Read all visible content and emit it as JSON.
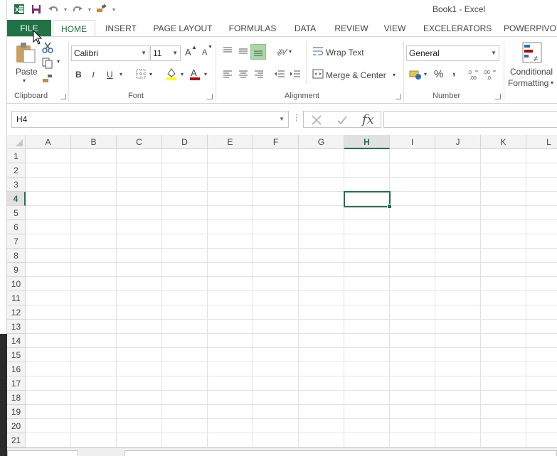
{
  "window": {
    "title": "Book1 - Excel"
  },
  "qat": {
    "icons": [
      "excel-logo-icon",
      "save-icon",
      "undo-icon",
      "redo-icon",
      "format-painter-icon",
      "customize-qat-icon"
    ]
  },
  "tabs": [
    {
      "key": "file",
      "label": "FILE"
    },
    {
      "key": "home",
      "label": "HOME"
    },
    {
      "key": "insert",
      "label": "INSERT"
    },
    {
      "key": "page-layout",
      "label": "PAGE LAYOUT"
    },
    {
      "key": "formulas",
      "label": "FORMULAS"
    },
    {
      "key": "data",
      "label": "DATA"
    },
    {
      "key": "review",
      "label": "REVIEW"
    },
    {
      "key": "view",
      "label": "VIEW"
    },
    {
      "key": "excelerators",
      "label": "EXCELERATORS"
    },
    {
      "key": "powerpivot",
      "label": "POWERPIVOT"
    }
  ],
  "ribbon": {
    "clipboard": {
      "label": "Clipboard",
      "paste_label": "Paste"
    },
    "font": {
      "label": "Font",
      "font_name": "Calibri",
      "font_size": "11",
      "bold": "B",
      "italic": "I",
      "underline": "U",
      "grow": "A",
      "shrink": "A"
    },
    "alignment": {
      "label": "Alignment",
      "wrap_text": "Wrap Text",
      "merge_center": "Merge & Center"
    },
    "number": {
      "label": "Number",
      "format": "General",
      "percent": "%",
      "comma": ","
    },
    "styles": {
      "conditional_line1": "Conditional",
      "conditional_line2": "Formatting"
    }
  },
  "formula_bar": {
    "name_box": "H4",
    "fx": "fx",
    "value": ""
  },
  "grid": {
    "columns": [
      "A",
      "B",
      "C",
      "D",
      "E",
      "F",
      "G",
      "H",
      "I",
      "J",
      "K",
      "L"
    ],
    "rows": [
      "1",
      "2",
      "3",
      "4",
      "5",
      "6",
      "7",
      "8",
      "9",
      "10",
      "11",
      "12",
      "13",
      "14",
      "15",
      "16",
      "17",
      "18",
      "19",
      "20",
      "21"
    ],
    "selected_column": "H",
    "selected_row": "4"
  },
  "colors": {
    "accent": "#217346",
    "fill_highlight": "#ffff00",
    "font_color": "#c00000"
  }
}
